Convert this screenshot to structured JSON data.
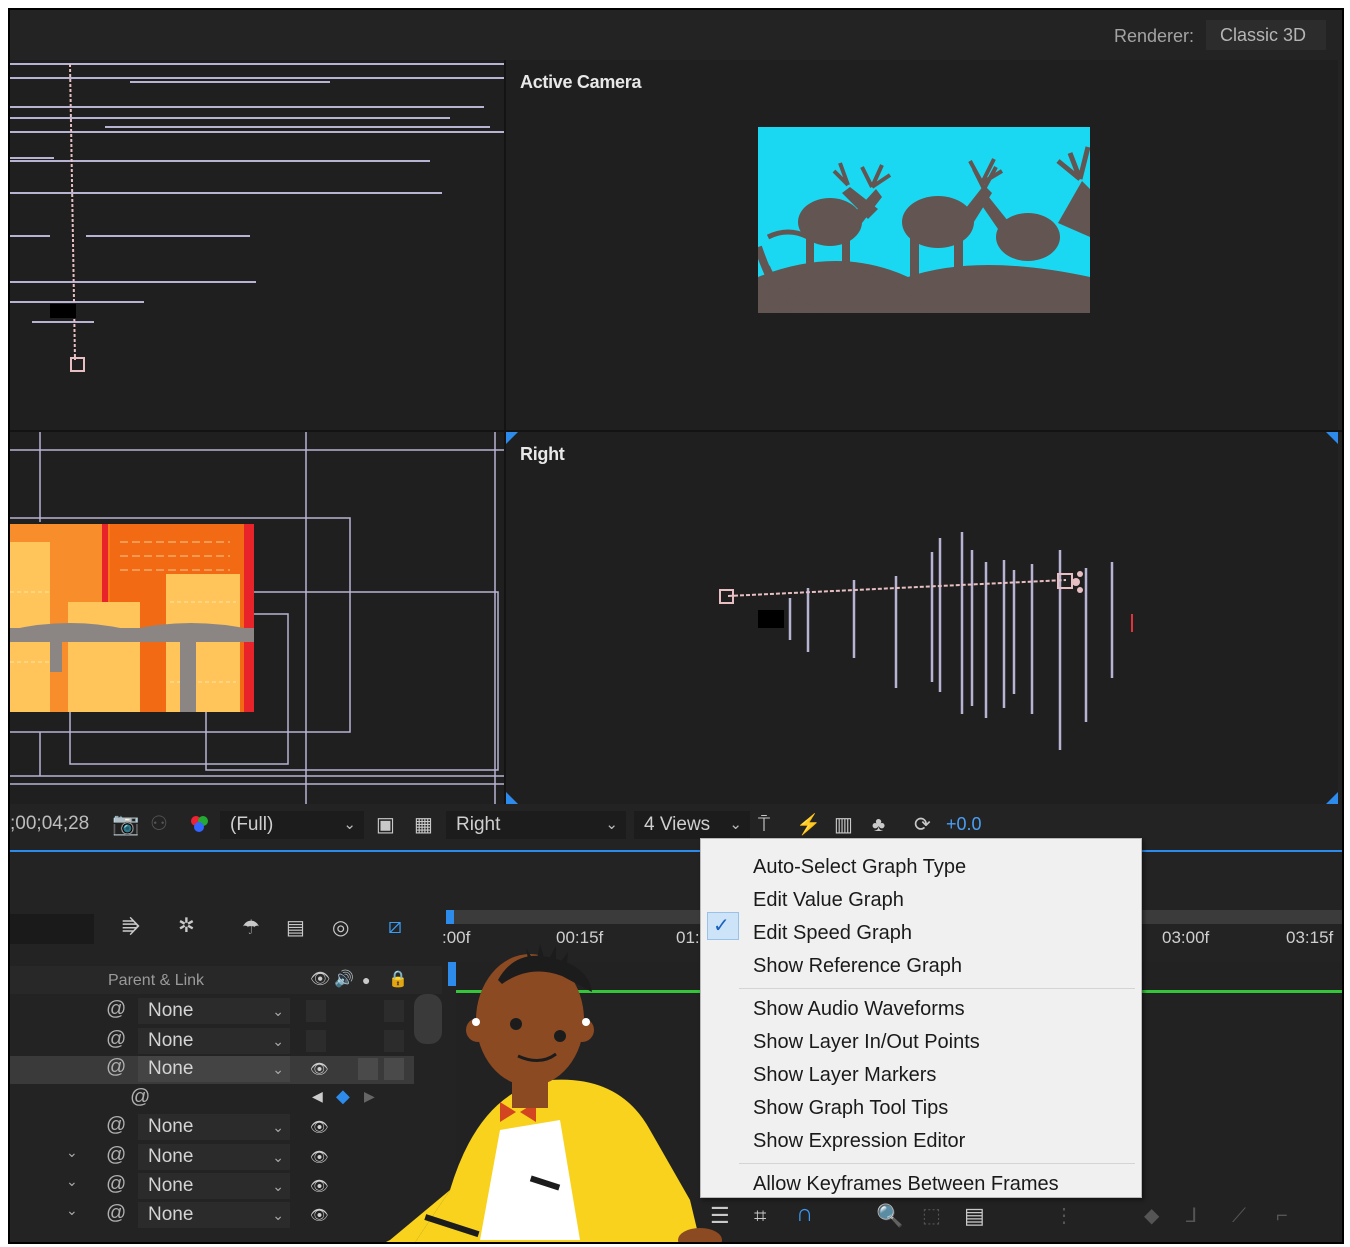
{
  "renderer": {
    "label": "Renderer:",
    "value": "Classic 3D"
  },
  "views": {
    "top_right_label": "Active Camera",
    "bottom_right_label": "Right"
  },
  "toolbar": {
    "timecode": ";00;04;28",
    "resolution": "(Full)",
    "view": "Right",
    "layout": "4 Views",
    "exposure": "+0.0"
  },
  "menu": {
    "items": [
      {
        "label": "Auto-Select Graph Type",
        "checked": false
      },
      {
        "label": "Edit Value Graph",
        "checked": false
      },
      {
        "label": "Edit Speed Graph",
        "checked": true
      },
      {
        "label": "Show Reference Graph",
        "checked": false
      },
      {
        "label": "Show Audio Waveforms",
        "checked": false
      },
      {
        "label": "Show Layer In/Out Points",
        "checked": false
      },
      {
        "label": "Show Layer Markers",
        "checked": false
      },
      {
        "label": "Show Graph Tool Tips",
        "checked": false
      },
      {
        "label": "Show Expression Editor",
        "checked": false
      },
      {
        "label": "Allow Keyframes Between Frames",
        "checked": false
      }
    ]
  },
  "timeline": {
    "parent_link_header": "Parent & Link",
    "parent_values": [
      "None",
      "None",
      "None",
      "None",
      "None",
      "None",
      "None"
    ],
    "ruler": [
      ":00f",
      "00:15f",
      "01:",
      "03:00f",
      "03:15f"
    ]
  },
  "colors": {
    "panel_bg": "#232323",
    "viewer_bg": "#1f1f1f",
    "accent_blue": "#2d8ceb",
    "wire_lilac": "#b7b3d3",
    "sky_cyan": "#1bd8f2",
    "menu_bg": "#f0f0f0",
    "check_highlight": "#cde3f7"
  }
}
